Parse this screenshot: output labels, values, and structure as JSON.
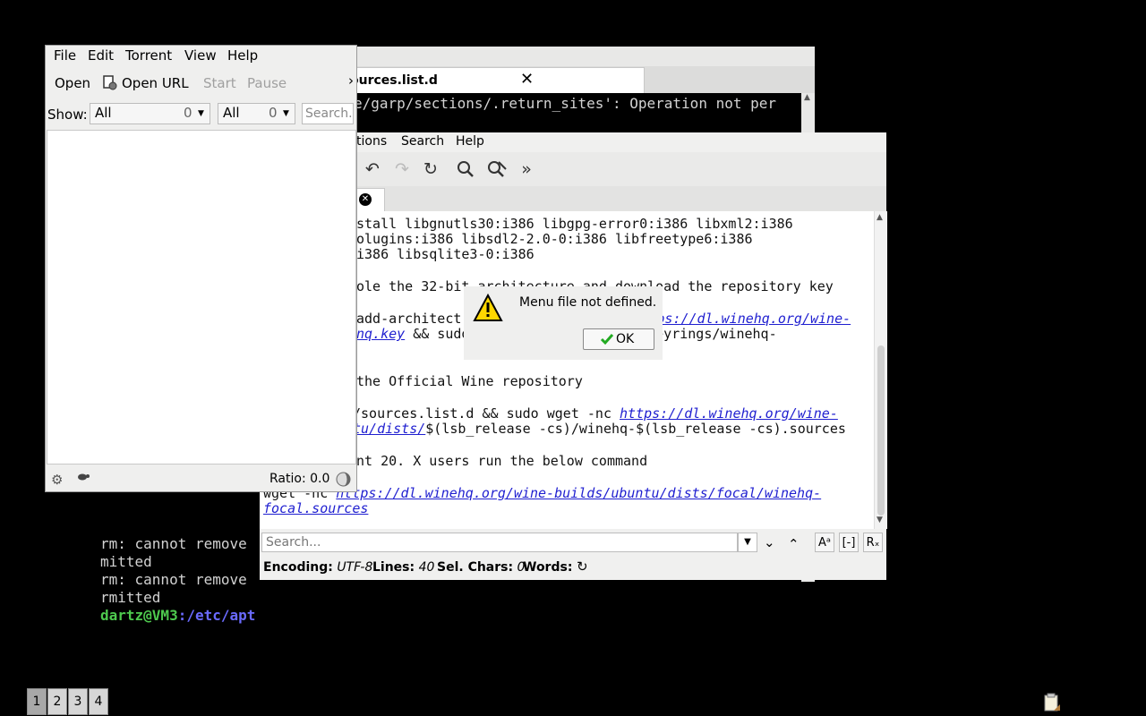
{
  "terminal": {
    "tab_title": "ources.list.d",
    "close_glyph": "✕",
    "lines": [
      "e/garp/sections/.return_sites': Operation not per",
      "rm: cannot remove",
      "mitted",
      "rm: cannot remove",
      "rmitted"
    ],
    "prompt_user": "dartz@VM3",
    "prompt_path": ":/etc/apt"
  },
  "editor": {
    "menu": {
      "options": "tions",
      "search": "Search",
      "help": "Help"
    },
    "toolbar_icons": [
      "undo-icon",
      "redo-icon",
      "reload-icon",
      "search-icon",
      "search-replace-icon",
      "more-icon"
    ],
    "text_lines": [
      {
        "pre": "stall libgnutls30:i386 libgpg-error0:i386 libxml2:i386"
      },
      {
        "pre": "olugins:i386 libsdl2-2.0-0:i386 libfreetype6:i386"
      },
      {
        "pre": "i386 libsqlite3-0:i386"
      },
      {
        "pre": "ole the 32-bit architecture and download the repository key"
      },
      {
        "pre": "add-architect",
        "link": "ps://dl.winehq.org/wine-"
      },
      {
        "link_pre": "nq.key",
        "post": " && sudo                    e/keyrings/winehq-"
      },
      {
        "pre": "the Official Wine repository"
      },
      {
        "pre": "/sources.list.d && sudo wget -nc ",
        "link": "https://dl.winehq.org/wine-"
      },
      {
        "link_pre": "tu/dists/",
        "post": "$(lsb_release -cs)/winehq-$(lsb_release -cs).sources"
      },
      {
        "pre": "nt 20. X users run the below command"
      },
      {
        "pre": "wget -nc ",
        "link": "https://dl.winehq.org/wine-builds/ubuntu/dists/focal/winehq-"
      },
      {
        "link_pre": "focal.sources"
      }
    ],
    "search_placeholder": "Search...",
    "status": {
      "encoding_label": "Encoding:",
      "encoding_value": "UTF-8",
      "lines_label": "Lines:",
      "lines_value": "40",
      "sel_label": "Sel. Chars:",
      "sel_value": "0",
      "words_label": "Words:"
    }
  },
  "transmission": {
    "menu": {
      "file": "File",
      "edit": "Edit",
      "torrent": "Torrent",
      "view": "View",
      "help": "Help"
    },
    "toolbar": {
      "open": "Open",
      "open_url": "Open URL",
      "start": "Start",
      "pause": "Pause",
      "overflow": "›"
    },
    "filter": {
      "show_label": "Show:",
      "activity": "All",
      "activity_count": "0",
      "tracker": "All",
      "tracker_count": "0",
      "search_placeholder": "Search..."
    },
    "status": {
      "ratio": "Ratio: 0.0"
    }
  },
  "alert": {
    "message": "Menu file not defined.",
    "ok_label": "OK"
  },
  "taskbar": {
    "workspaces": [
      "1",
      "2",
      "3",
      "4"
    ],
    "active_workspace": "1"
  }
}
